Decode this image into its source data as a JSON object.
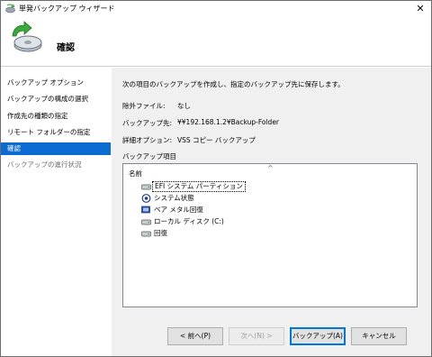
{
  "window": {
    "title": "単発バックアップ ウィザード",
    "close_glyph": "✕"
  },
  "header": {
    "title": "確認"
  },
  "sidebar": {
    "items": [
      {
        "label": "バックアップ オプション",
        "state": "normal"
      },
      {
        "label": "バックアップの構成の選択",
        "state": "normal"
      },
      {
        "label": "作成先の種類の指定",
        "state": "normal"
      },
      {
        "label": "リモート フォルダーの指定",
        "state": "normal"
      },
      {
        "label": "確認",
        "state": "active"
      },
      {
        "label": "バックアップの進行状況",
        "state": "disabled"
      }
    ]
  },
  "main": {
    "intro": "次の項目のバックアップを作成し、指定のバックアップ先に保存します。",
    "excluded_label": "除外ファイル:",
    "excluded_value": "なし",
    "destination_label": "バックアップ先:",
    "destination_value": "¥¥192.168.1.2¥Backup-Folder",
    "advanced_label": "詳細オプション:",
    "advanced_value": "VSS コピー バックアップ",
    "items_label": "バックアップ項目",
    "tree": {
      "column_header": "名前",
      "sort_glyph": "^",
      "items": [
        {
          "label": "EFI システム パーティション",
          "icon": "drive-icon"
        },
        {
          "label": "システム状態",
          "icon": "system-state-icon"
        },
        {
          "label": "ベア メタル回復",
          "icon": "bare-metal-icon"
        },
        {
          "label": "ローカル ディスク (C:)",
          "icon": "drive-icon"
        },
        {
          "label": "回復",
          "icon": "drive-icon"
        }
      ]
    }
  },
  "buttons": {
    "back": "< 前へ(P)",
    "next": "次へ(N) >",
    "backup": "バックアップ(A)",
    "cancel": "キャンセル"
  },
  "colors": {
    "accent": "#0c6bd1",
    "content_bg": "#f0f0f0"
  }
}
